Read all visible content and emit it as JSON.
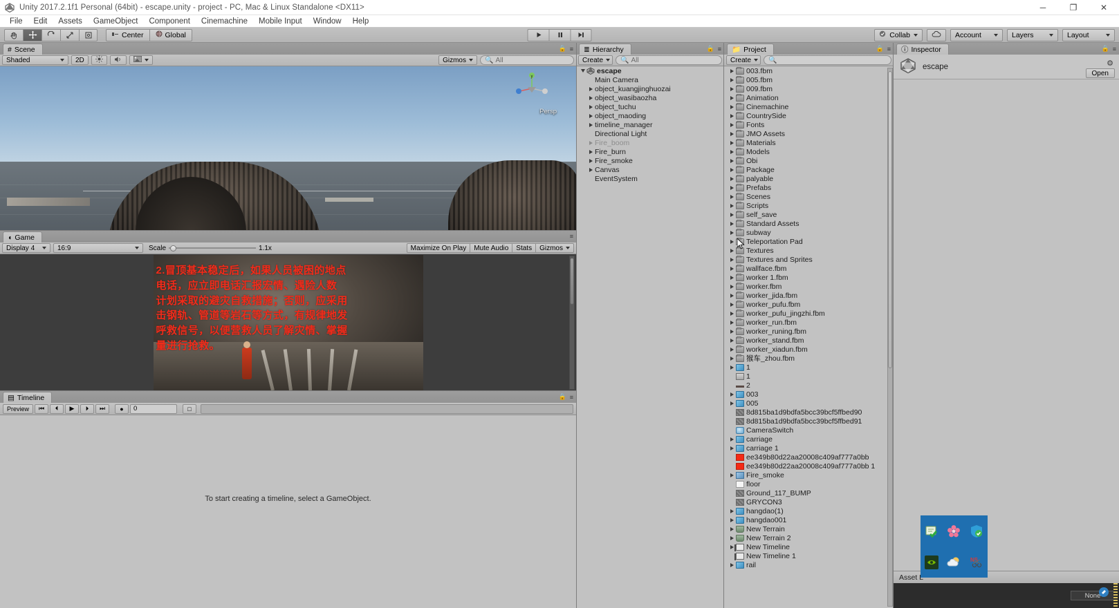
{
  "window": {
    "title": "Unity 2017.2.1f1 Personal (64bit) - escape.unity - project - PC, Mac & Linux Standalone <DX11>",
    "minimize": "─",
    "maximize": "❐",
    "close": "✕"
  },
  "menu": {
    "items": [
      "File",
      "Edit",
      "Assets",
      "GameObject",
      "Component",
      "Cinemachine",
      "Mobile Input",
      "Window",
      "Help"
    ]
  },
  "toolbar": {
    "tools": [
      "hand-tool",
      "move-tool",
      "rotate-tool",
      "scale-tool",
      "rect-tool"
    ],
    "pivot": "Center",
    "space": "Global",
    "play": "▶",
    "pause": "❙❙",
    "step": "▶❙",
    "collab": "Collab",
    "cloud": "cloud-icon",
    "account": "Account",
    "layers": "Layers",
    "layout": "Layout"
  },
  "scene": {
    "tab": "Scene",
    "shading": "Shaded",
    "mode2d": "2D",
    "lighting": "lighting-icon",
    "audio": "audio-icon",
    "effects": "effects-icon",
    "gizmos": "Gizmos",
    "search_placeholder": "All",
    "perspective_label": "Persp",
    "axis_y": "y",
    "axis_x": "x",
    "axis_z": "z"
  },
  "game": {
    "tab": "Game",
    "display": "Display 4",
    "aspect": "16:9",
    "scale_label": "Scale",
    "scale_value": "1.1x",
    "maximize": "Maximize On Play",
    "mute": "Mute Audio",
    "stats": "Stats",
    "gizmos": "Gizmos",
    "overlay_lines": [
      "2.冒顶基本稳定后，如果人员被困的地点",
      "电话，应立即电话汇报宏情、遇险人数",
      "计划采取的避灾自救措施；否则，应采用",
      "击钢轨、管道等岩石等方式，有规律地发",
      "呼救信号，以便营救人员了解灾情、掌握",
      "量进行抢救。"
    ]
  },
  "timeline": {
    "tab": "Timeline",
    "preview": "Preview",
    "first": "⏮",
    "prev": "⏴",
    "play": "▶",
    "next": "⏵",
    "last": "⏭",
    "record": "●",
    "frame": "0",
    "lock": "□",
    "empty_message": "To start creating a timeline, select a GameObject."
  },
  "hierarchy": {
    "tab": "Hierarchy",
    "create": "Create",
    "search_placeholder": "All",
    "items": [
      {
        "label": "escape",
        "depth": 0,
        "arrow": "down",
        "icon": "unity-scene-icon",
        "dim": false
      },
      {
        "label": "Main Camera",
        "depth": 1,
        "arrow": "none",
        "icon": "",
        "dim": false
      },
      {
        "label": "object_kuangjinghuozai",
        "depth": 1,
        "arrow": "right",
        "icon": "",
        "dim": false
      },
      {
        "label": "object_wasibaozha",
        "depth": 1,
        "arrow": "right",
        "icon": "",
        "dim": false
      },
      {
        "label": "object_tuchu",
        "depth": 1,
        "arrow": "right",
        "icon": "",
        "dim": false
      },
      {
        "label": "object_maoding",
        "depth": 1,
        "arrow": "right",
        "icon": "",
        "dim": false
      },
      {
        "label": "timeline_manager",
        "depth": 1,
        "arrow": "right",
        "icon": "",
        "dim": false
      },
      {
        "label": "Directional Light",
        "depth": 1,
        "arrow": "none",
        "icon": "",
        "dim": false
      },
      {
        "label": "Fire_boom",
        "depth": 1,
        "arrow": "right",
        "icon": "",
        "dim": true
      },
      {
        "label": "Fire_burn",
        "depth": 1,
        "arrow": "right",
        "icon": "",
        "dim": false
      },
      {
        "label": "Fire_smoke",
        "depth": 1,
        "arrow": "right",
        "icon": "",
        "dim": false
      },
      {
        "label": "Canvas",
        "depth": 1,
        "arrow": "right",
        "icon": "",
        "dim": false
      },
      {
        "label": "EventSystem",
        "depth": 1,
        "arrow": "none",
        "icon": "",
        "dim": false
      }
    ]
  },
  "project": {
    "tab": "Project",
    "create": "Create",
    "search_placeholder": "",
    "items": [
      {
        "label": "003.fbm",
        "icon": "folder",
        "arrow": true
      },
      {
        "label": "005.fbm",
        "icon": "folder",
        "arrow": true
      },
      {
        "label": "009.fbm",
        "icon": "folder",
        "arrow": true
      },
      {
        "label": "Animation",
        "icon": "folder",
        "arrow": true
      },
      {
        "label": "Cinemachine",
        "icon": "folder",
        "arrow": true
      },
      {
        "label": "CountrySide",
        "icon": "folder",
        "arrow": true
      },
      {
        "label": "Fonts",
        "icon": "folder",
        "arrow": true
      },
      {
        "label": "JMO Assets",
        "icon": "folder",
        "arrow": true
      },
      {
        "label": "Materials",
        "icon": "folder",
        "arrow": true
      },
      {
        "label": "Models",
        "icon": "folder",
        "arrow": true
      },
      {
        "label": "Obi",
        "icon": "folder",
        "arrow": true
      },
      {
        "label": "Package",
        "icon": "folder",
        "arrow": true
      },
      {
        "label": "palyable",
        "icon": "folder",
        "arrow": true
      },
      {
        "label": "Prefabs",
        "icon": "folder",
        "arrow": true
      },
      {
        "label": "Scenes",
        "icon": "folder",
        "arrow": true
      },
      {
        "label": "Scripts",
        "icon": "folder",
        "arrow": true
      },
      {
        "label": "self_save",
        "icon": "folder",
        "arrow": true
      },
      {
        "label": "Standard Assets",
        "icon": "folder",
        "arrow": true
      },
      {
        "label": "subway",
        "icon": "folder",
        "arrow": true
      },
      {
        "label": "Teleportation Pad",
        "icon": "folder",
        "arrow": true
      },
      {
        "label": "Textures",
        "icon": "folder",
        "arrow": true
      },
      {
        "label": "Textures and Sprites",
        "icon": "folder",
        "arrow": true
      },
      {
        "label": "wallface.fbm",
        "icon": "folder",
        "arrow": true
      },
      {
        "label": "worker 1.fbm",
        "icon": "folder",
        "arrow": true
      },
      {
        "label": "worker.fbm",
        "icon": "folder",
        "arrow": true
      },
      {
        "label": "worker_jida.fbm",
        "icon": "folder",
        "arrow": true
      },
      {
        "label": "worker_pufu.fbm",
        "icon": "folder",
        "arrow": true
      },
      {
        "label": "worker_pufu_jingzhi.fbm",
        "icon": "folder",
        "arrow": true
      },
      {
        "label": "worker_run.fbm",
        "icon": "folder",
        "arrow": true
      },
      {
        "label": "worker_runing.fbm",
        "icon": "folder",
        "arrow": true
      },
      {
        "label": "worker_stand.fbm",
        "icon": "folder",
        "arrow": true
      },
      {
        "label": "worker_xiadun.fbm",
        "icon": "folder",
        "arrow": true
      },
      {
        "label": "猴车_zhou.fbm",
        "icon": "folder",
        "arrow": true
      },
      {
        "label": "1",
        "icon": "prefab",
        "arrow": true
      },
      {
        "label": "1",
        "icon": "mesh",
        "arrow": false
      },
      {
        "label": "2",
        "icon": "line",
        "arrow": false
      },
      {
        "label": "003",
        "icon": "prefab",
        "arrow": true
      },
      {
        "label": "005",
        "icon": "prefab",
        "arrow": true
      },
      {
        "label": "8d815ba1d9bdfa5bcc39bcf5ffbed90",
        "icon": "tex",
        "arrow": false
      },
      {
        "label": "8d815ba1d9bdfa5bcc39bcf5ffbed91",
        "icon": "tex",
        "arrow": false
      },
      {
        "label": "CameraSwitch",
        "icon": "script",
        "arrow": false
      },
      {
        "label": "carriage",
        "icon": "prefab",
        "arrow": true
      },
      {
        "label": "carriage 1",
        "icon": "prefab",
        "arrow": true
      },
      {
        "label": "ee349b80d22aa20008c409af777a0bb",
        "icon": "red",
        "arrow": false
      },
      {
        "label": "ee349b80d22aa20008c409af777a0bb 1",
        "icon": "red",
        "arrow": false
      },
      {
        "label": "Fire_smoke",
        "icon": "smoke",
        "arrow": true
      },
      {
        "label": "floor",
        "icon": "white",
        "arrow": false
      },
      {
        "label": "Ground_117_BUMP",
        "icon": "tex",
        "arrow": false
      },
      {
        "label": "GRYCON3",
        "icon": "tex",
        "arrow": false
      },
      {
        "label": "hangdao(1)",
        "icon": "prefab",
        "arrow": true
      },
      {
        "label": "hangdao001",
        "icon": "prefab",
        "arrow": true
      },
      {
        "label": "New Terrain",
        "icon": "terrain",
        "arrow": true
      },
      {
        "label": "New Terrain 2",
        "icon": "terrain",
        "arrow": true
      },
      {
        "label": "New Timeline",
        "icon": "timeline",
        "arrow": true
      },
      {
        "label": "New Timeline 1",
        "icon": "timeline",
        "arrow": false
      },
      {
        "label": "rail",
        "icon": "prefab",
        "arrow": true
      }
    ]
  },
  "inspector": {
    "tab": "Inspector",
    "asset_name": "escape",
    "open_button": "Open",
    "gear": "gear-icon"
  },
  "bottom": {
    "asset_label": "Asset L",
    "none_value": "None"
  }
}
